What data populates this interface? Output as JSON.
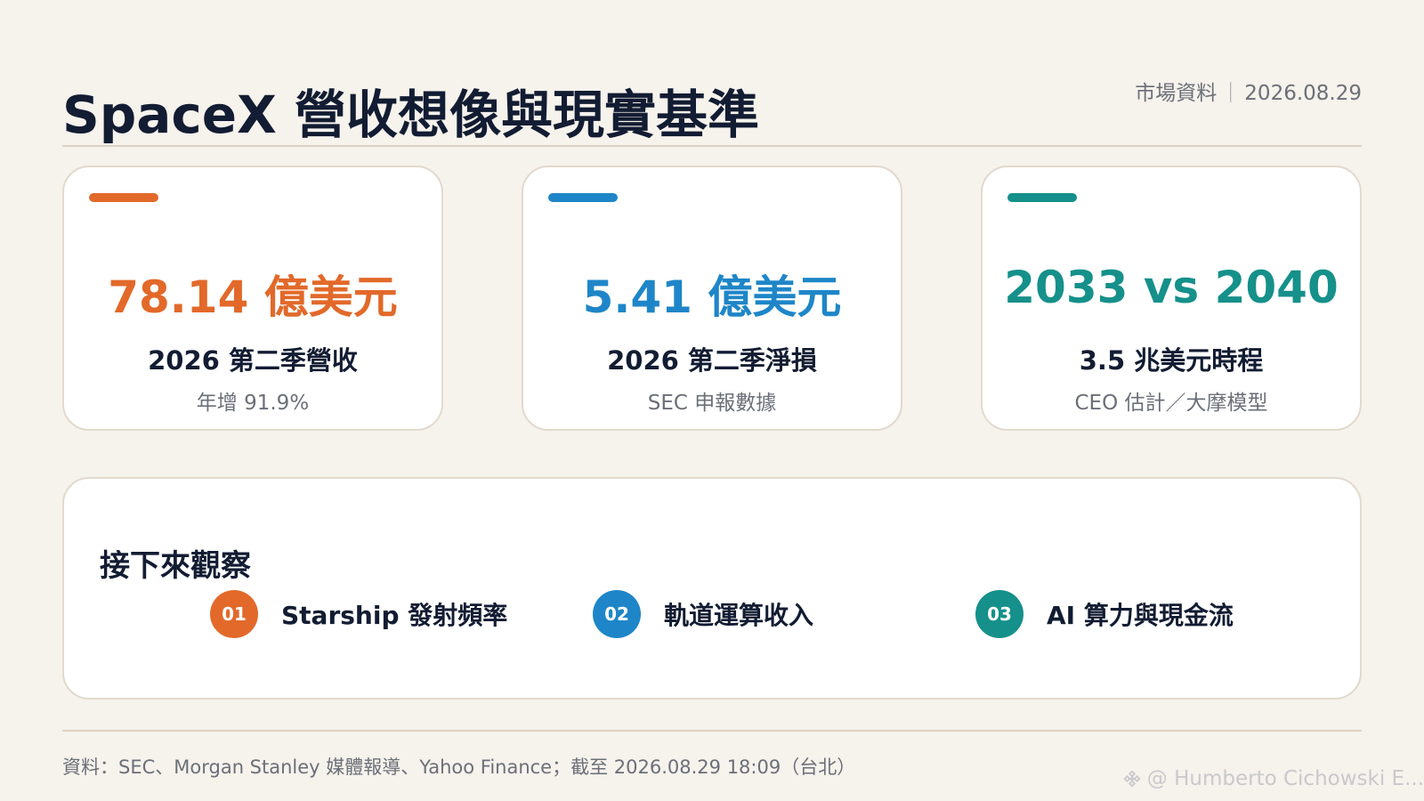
{
  "header": {
    "title": "SpaceX 營收想像與現實基準",
    "meta_label": "市場資料",
    "meta_separator": "｜",
    "meta_date": "2026.08.29"
  },
  "cards": [
    {
      "value": "78.14 億美元",
      "label": "2026 第二季營收",
      "note": "年增 91.9%",
      "color": "#e2692a"
    },
    {
      "value": "5.41 億美元",
      "label": "2026 第二季淨損",
      "note": "SEC 申報數據",
      "color": "#1e86c8"
    },
    {
      "value": "2033 vs 2040",
      "label": "3.5 兆美元時程",
      "note": "CEO 估計／大摩模型",
      "color": "#15908a"
    }
  ],
  "watch": {
    "title": "接下來觀察",
    "items": [
      {
        "num": "01",
        "text": "Starship 發射頻率",
        "color": "#e2692a"
      },
      {
        "num": "02",
        "text": "軌道運算收入",
        "color": "#1e86c8"
      },
      {
        "num": "03",
        "text": "AI 算力與現金流",
        "color": "#15908a"
      }
    ]
  },
  "footer": {
    "source": "資料：SEC、Morgan Stanley 媒體報導、Yahoo Finance；截至 2026.08.29 18:09（台北）"
  },
  "watermark": {
    "text": "@ Humberto Cichowski E...",
    "icon": "binance-diamond-icon"
  }
}
